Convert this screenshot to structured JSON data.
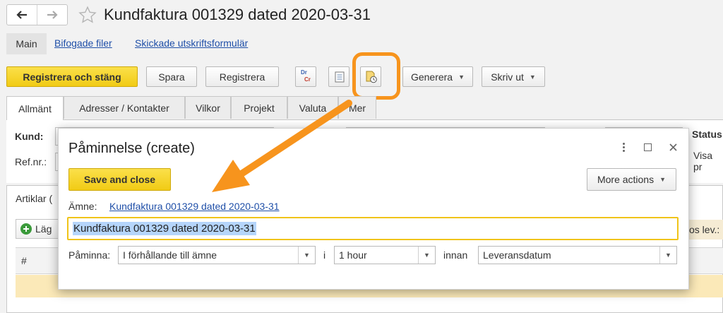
{
  "nav": {
    "back_icon": "arrow-left-icon",
    "forward_icon": "arrow-right-icon",
    "favorite_icon": "star-icon"
  },
  "page": {
    "title": "Kundfaktura 001329 dated 2020-03-31"
  },
  "section_tabs": [
    {
      "label": "Main"
    },
    {
      "label": "Bifogade filer"
    },
    {
      "label": "Skickade utskriftsformulär"
    }
  ],
  "toolbar": {
    "post_and_close": "Registrera och stäng",
    "save": "Spara",
    "post": "Registrera",
    "drcr_icon": "dr-cr-icon",
    "drcr_top": "Dr",
    "drcr_bottom": "Cr",
    "document_icon": "document-icon",
    "reminder_icon": "reminder-clock-icon",
    "generate": "Generera",
    "print": "Skriv ut"
  },
  "form_tabs": [
    {
      "label": "Allmänt"
    },
    {
      "label": "Adresser / Kontakter"
    },
    {
      "label": "Vilkor"
    },
    {
      "label": "Projekt"
    },
    {
      "label": "Valuta"
    },
    {
      "label": "Mer"
    }
  ],
  "form": {
    "customer_label": "Kund:",
    "ref_label": "Ref.nr.:",
    "status_label": "Status",
    "status_value": "Visa pr"
  },
  "items": {
    "tab_label": "Artiklar (",
    "add_label": "Läg",
    "column_number": "#",
    "supplier_col": "os lev.:"
  },
  "dialog": {
    "title": "Påminnelse (create)",
    "menu_icon": "more-vertical-icon",
    "maximize_icon": "maximize-icon",
    "close_icon": "close-icon",
    "save_and_close": "Save and close",
    "more_actions": "More actions",
    "subject_label": "Ämne:",
    "subject_link": "Kundfaktura 001329 dated 2020-03-31",
    "subject_value": "Kundfaktura 001329 dated 2020-03-31",
    "remind_label": "Påminna:",
    "relation_value": "I förhållande till ämne",
    "i_label": "i",
    "period_value": "1 hour",
    "before_label": "innan",
    "date_field_value": "Leveransdatum"
  },
  "colors": {
    "highlight": "#f7941d",
    "accent_yellow": "#f5d328",
    "link": "#1f4fa8",
    "selection": "#b5d5fb"
  }
}
